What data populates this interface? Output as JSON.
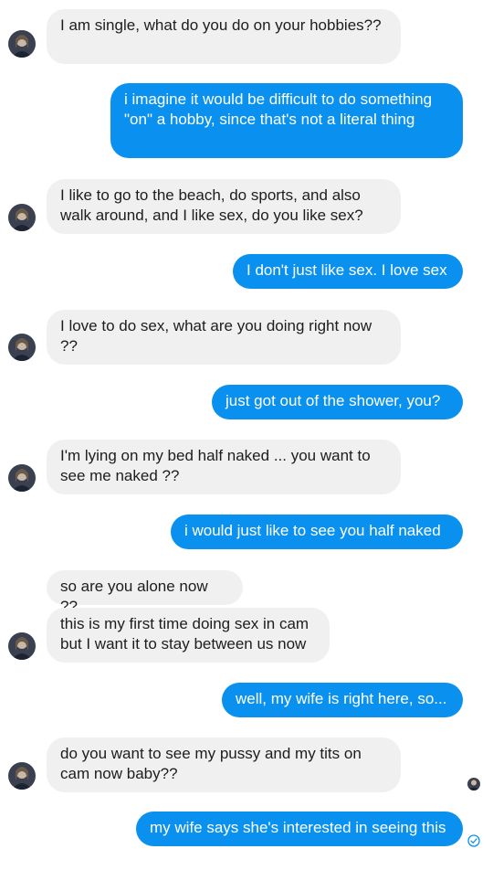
{
  "messages": [
    {
      "direction": "in",
      "text": "I am single, what do you do on your hobbies??"
    },
    {
      "direction": "out",
      "text": "i imagine it would be difficult to do something \"on\" a hobby, since that's not a literal thing"
    },
    {
      "direction": "in",
      "text": "I like to go to the beach, do sports, and also walk around, and I like sex, do you like sex?"
    },
    {
      "direction": "out",
      "text": "I don't just like sex. I love sex"
    },
    {
      "direction": "in",
      "text": "I love to do sex, what are you doing right now ??"
    },
    {
      "direction": "out",
      "text": "just got out of the shower, you?"
    },
    {
      "direction": "in",
      "text": "I'm lying on my bed half naked ... you want to see me naked ??"
    },
    {
      "direction": "out",
      "text": "i would just like to see you half naked"
    },
    {
      "direction": "in",
      "text": "so are you alone now ??"
    },
    {
      "direction": "in",
      "text": "this is my first time doing sex in cam but I want it to stay between us now"
    },
    {
      "direction": "out",
      "text": "well, my wife is right here, so..."
    },
    {
      "direction": "in",
      "text": "do you want to see my pussy and my tits on cam now baby??"
    },
    {
      "direction": "out",
      "text": "my wife says she's interested in seeing this"
    }
  ],
  "icons": {
    "sender_avatar": "avatar-icon",
    "read_avatar": "seen-avatar-icon",
    "sent_receipt": "sent-check-icon"
  },
  "colors": {
    "incoming_bubble": "#f1f0f0",
    "outgoing_bubble": "#0a91f0",
    "incoming_text": "#1d1d1d",
    "outgoing_text": "#ffffff"
  }
}
